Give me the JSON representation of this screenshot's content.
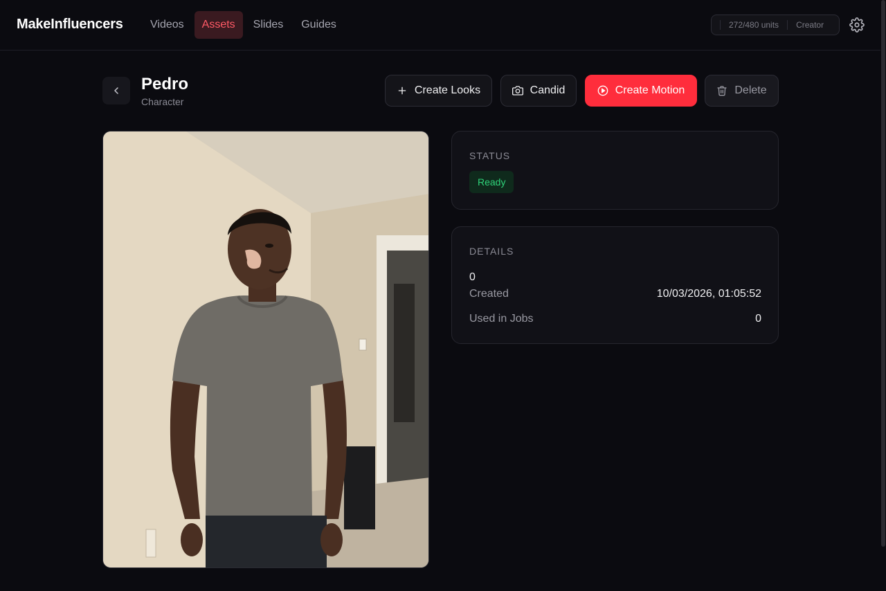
{
  "app": {
    "brand": "MakeInfluencers"
  },
  "nav": [
    {
      "label": "Videos",
      "active": false
    },
    {
      "label": "Assets",
      "active": true
    },
    {
      "label": "Slides",
      "active": false
    },
    {
      "label": "Guides",
      "active": false
    }
  ],
  "usage": {
    "units": "272/480 units",
    "plan": "Creator"
  },
  "asset": {
    "name": "Pedro",
    "type": "Character"
  },
  "actions": {
    "create_looks": "Create Looks",
    "candid": "Candid",
    "create_motion": "Create Motion",
    "delete": "Delete"
  },
  "status": {
    "label": "STATUS",
    "value": "Ready"
  },
  "details": {
    "label": "DETAILS",
    "value": "0",
    "created_label": "Created",
    "created_value": "10/03/2026, 01:05:52",
    "jobs_label": "Used in Jobs",
    "jobs_value": "0"
  },
  "colors": {
    "accent": "#ff2d3c",
    "active_nav_bg": "#3a1a20",
    "active_nav_text": "#ff5a66",
    "ready_bg": "#0f2a1c",
    "ready_text": "#2fd37a",
    "background": "#0b0b10"
  },
  "icons": {
    "back": "chevron-left-icon",
    "create_looks": "plus-icon",
    "candid": "camera-icon",
    "create_motion": "play-circle-icon",
    "delete": "trash-icon",
    "settings": "gear-icon"
  }
}
